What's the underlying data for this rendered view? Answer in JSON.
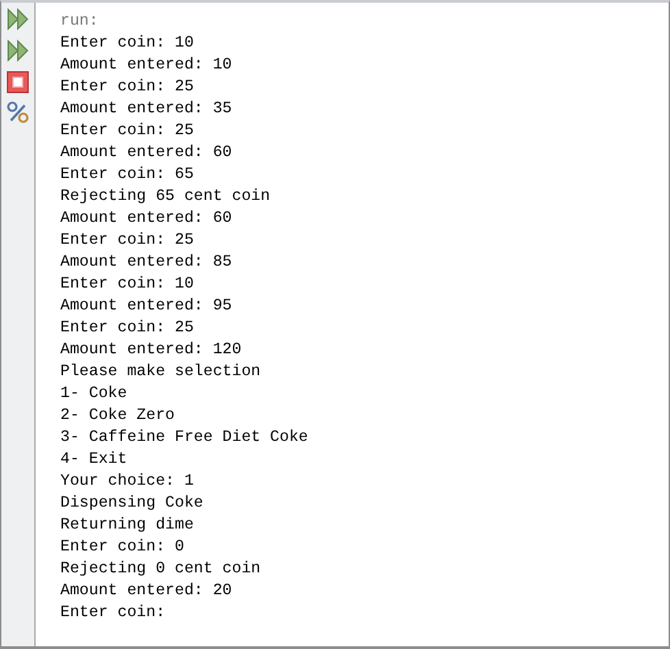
{
  "toolbar": [
    {
      "kind": "rerun"
    },
    {
      "kind": "rerun"
    },
    {
      "kind": "stop"
    },
    {
      "kind": "settings"
    }
  ],
  "output": [
    {
      "kind": "system",
      "text": "run:"
    },
    {
      "kind": "out",
      "text": "Enter coin: 10"
    },
    {
      "kind": "out",
      "text": "Amount entered: 10"
    },
    {
      "kind": "out",
      "text": "Enter coin: 25"
    },
    {
      "kind": "out",
      "text": "Amount entered: 35"
    },
    {
      "kind": "out",
      "text": "Enter coin: 25"
    },
    {
      "kind": "out",
      "text": "Amount entered: 60"
    },
    {
      "kind": "out",
      "text": "Enter coin: 65"
    },
    {
      "kind": "out",
      "text": "Rejecting 65 cent coin"
    },
    {
      "kind": "out",
      "text": "Amount entered: 60"
    },
    {
      "kind": "out",
      "text": "Enter coin: 25"
    },
    {
      "kind": "out",
      "text": "Amount entered: 85"
    },
    {
      "kind": "out",
      "text": "Enter coin: 10"
    },
    {
      "kind": "out",
      "text": "Amount entered: 95"
    },
    {
      "kind": "out",
      "text": "Enter coin: 25"
    },
    {
      "kind": "out",
      "text": "Amount entered: 120"
    },
    {
      "kind": "out",
      "text": "Please make selection"
    },
    {
      "kind": "out",
      "text": "1- Coke"
    },
    {
      "kind": "out",
      "text": "2- Coke Zero"
    },
    {
      "kind": "out",
      "text": "3- Caffeine Free Diet Coke"
    },
    {
      "kind": "out",
      "text": "4- Exit"
    },
    {
      "kind": "out",
      "text": "Your choice: 1"
    },
    {
      "kind": "out",
      "text": "Dispensing Coke"
    },
    {
      "kind": "out",
      "text": "Returning dime"
    },
    {
      "kind": "out",
      "text": "Enter coin: 0"
    },
    {
      "kind": "out",
      "text": "Rejecting 0 cent coin"
    },
    {
      "kind": "out",
      "text": "Amount entered: 20"
    },
    {
      "kind": "out",
      "text": "Enter coin:"
    }
  ]
}
